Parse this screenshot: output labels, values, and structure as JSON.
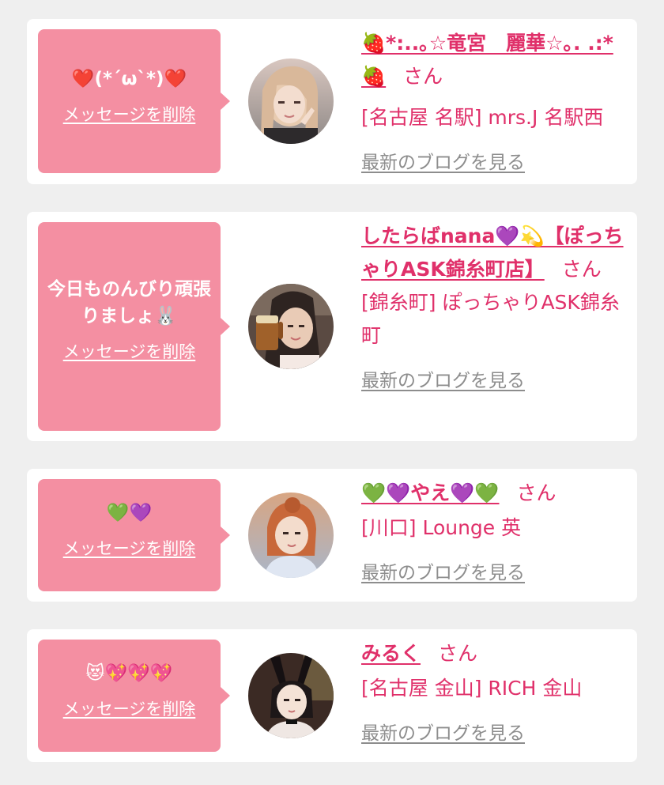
{
  "accent_color": "#e0306a",
  "bubble_color": "#f48fa2",
  "cards": [
    {
      "message": "❤️(*´ω`*)❤️",
      "delete_label": "メッセージを削除",
      "name": "🍓*:..｡☆竜宮　麗華☆｡. .:*🍓",
      "san": "さん",
      "shop": "[名古屋 名駅] mrs.J 名駅西",
      "blog_label": "最新のブログを見る"
    },
    {
      "message": "今日ものんびり頑張りましょ🐰",
      "delete_label": "メッセージを削除",
      "name": "したらばnana💜💫【ぽっちゃりASK錦糸町店】",
      "san": "さん",
      "shop": "[錦糸町] ぽっちゃりASK錦糸町",
      "blog_label": "最新のブログを見る"
    },
    {
      "message": "💚💜",
      "delete_label": "メッセージを削除",
      "name": "💚💜やえ💜💚",
      "san": "さん",
      "shop": "[川口] Lounge 英",
      "blog_label": "最新のブログを見る"
    },
    {
      "message": "😻💖💖💖",
      "delete_label": "メッセージを削除",
      "name": "みるく",
      "san": "さん",
      "shop": "[名古屋 金山] RICH 金山",
      "blog_label": "最新のブログを見る"
    }
  ]
}
